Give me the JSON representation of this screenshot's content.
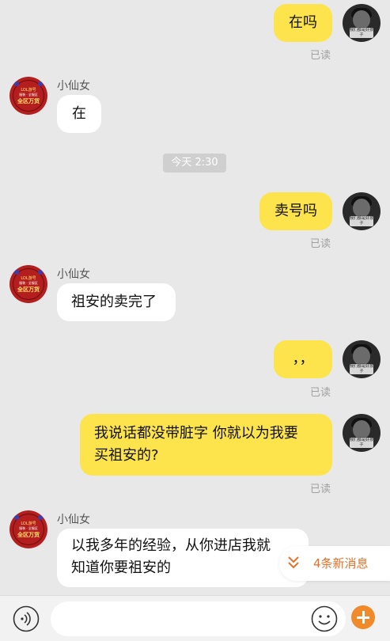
{
  "chat": {
    "contact_name": "小仙女",
    "read_label": "已读",
    "timestamp": "今天 2:30",
    "messages": [
      {
        "from": "me",
        "text": "在吗"
      },
      {
        "from": "them",
        "text": "在"
      },
      {
        "from": "me",
        "text": "卖号吗"
      },
      {
        "from": "them",
        "text": "祖安的卖完了"
      },
      {
        "from": "me",
        "text": "，，"
      },
      {
        "from": "me",
        "text_lines": [
          "我说话都没带脏字 你就以为我要",
          "买祖安的?"
        ]
      },
      {
        "from": "them",
        "text_lines": [
          "以我多年的经验，从你进店我就",
          "知道你要祖安的"
        ]
      }
    ]
  },
  "avatar_text": {
    "self_badge": "我们都是好孩子",
    "shop_line1": "LOL游号",
    "shop_line2": "服装 · 全服区",
    "shop_line3": "全区万货"
  },
  "new_messages": {
    "label": "4条新消息"
  },
  "input": {
    "placeholder": ""
  },
  "colors": {
    "my_bubble": "#fde34c",
    "their_bubble": "#ffffff",
    "accent": "#f08a2a",
    "background": "#e8e8e8"
  },
  "icons": [
    "voice-icon",
    "emoji-icon",
    "plus-icon",
    "double-chevron-down-icon"
  ]
}
